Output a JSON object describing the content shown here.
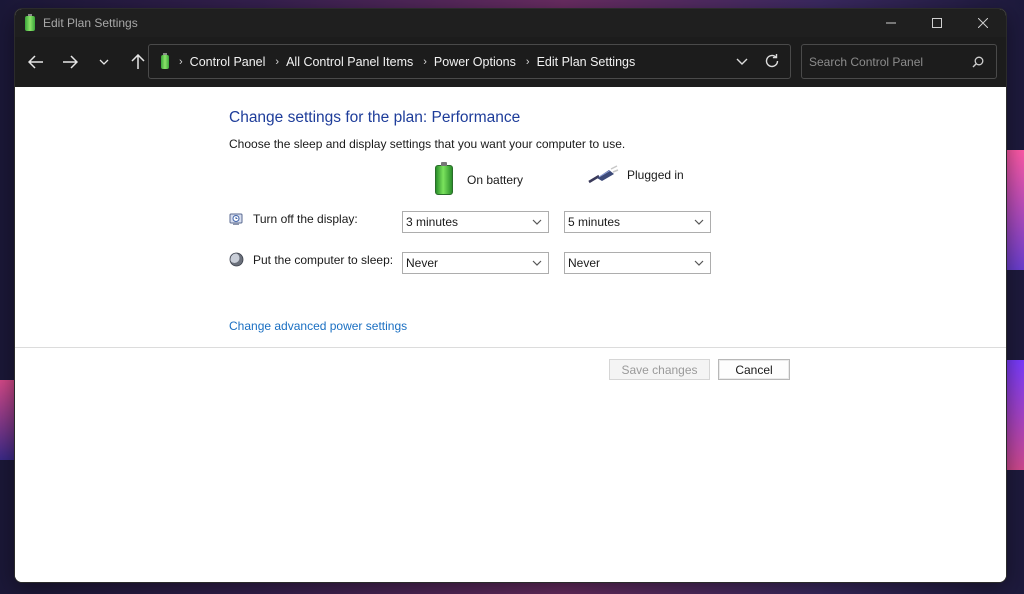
{
  "window": {
    "title": "Edit Plan Settings"
  },
  "navbar": {
    "breadcrumbs": [
      "Control Panel",
      "All Control Panel Items",
      "Power Options",
      "Edit Plan Settings"
    ],
    "search_placeholder": "Search Control Panel"
  },
  "content": {
    "heading": "Change settings for the plan: Performance",
    "subtext": "Choose the sleep and display settings that you want your computer to use.",
    "columns": {
      "battery": "On battery",
      "plugged": "Plugged in"
    },
    "rows": [
      {
        "label": "Turn off the display:",
        "battery": "3 minutes",
        "plugged": "5 minutes"
      },
      {
        "label": "Put the computer to sleep:",
        "battery": "Never",
        "plugged": "Never"
      }
    ],
    "advanced_link": "Change advanced power settings",
    "save_label": "Save changes",
    "cancel_label": "Cancel"
  },
  "colors": {
    "heading": "#1e3d9a",
    "link": "#1a6fc2",
    "titlebar": "#1f1f1f",
    "navbar": "#1c1c1c"
  }
}
